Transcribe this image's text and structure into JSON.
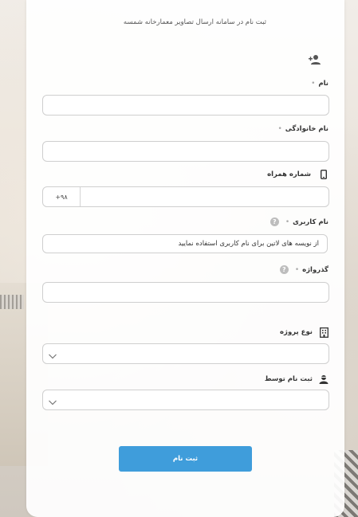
{
  "form": {
    "header": "ثبت نام در سامانه ارسال تصاویر معمارخانه شمسه",
    "fields": {
      "first_name": {
        "label": "نام",
        "required": "•",
        "value": ""
      },
      "last_name": {
        "label": "نام خانوادگی",
        "required": "•",
        "value": ""
      },
      "mobile": {
        "label": "شماره همراه",
        "prefix": "+۹۸",
        "value": ""
      },
      "username": {
        "label": "نام کاربری",
        "required": "•",
        "help": "?",
        "placeholder": "از نویسه های لاتین برای نام کاربری استفاده نمایید"
      },
      "password": {
        "label": "گذرواژه",
        "required": "•",
        "help": "?",
        "value": ""
      },
      "project_type": {
        "label": "نوع پروژه",
        "selected": ""
      },
      "registered_by": {
        "label": "ثبت نام توسط",
        "selected": ""
      }
    },
    "submit_label": "ثبت نام"
  },
  "colors": {
    "accent": "#3f9ddb"
  }
}
